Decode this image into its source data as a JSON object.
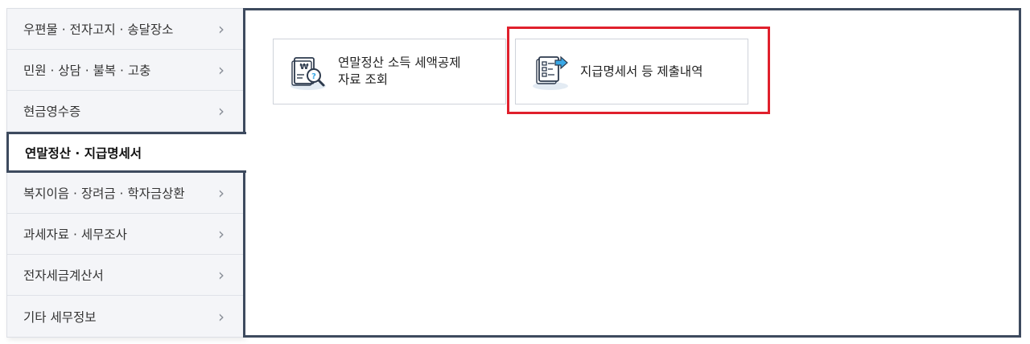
{
  "sidebar": {
    "items": [
      {
        "label": "우편물 · 전자고지 · 송달장소",
        "chevron": "›"
      },
      {
        "label": "민원 · 상담 · 불복 · 고충",
        "chevron": "›"
      },
      {
        "label": "현금영수증",
        "chevron": "›"
      },
      {
        "label": "연말정산 · 지급명세서",
        "chevron": ""
      },
      {
        "label": "복지이음 · 장려금 · 학자금상환",
        "chevron": "›"
      },
      {
        "label": "과세자료 · 세무조사",
        "chevron": "›"
      },
      {
        "label": "전자세금계산서",
        "chevron": "›"
      },
      {
        "label": "기타 세무정보",
        "chevron": "›"
      }
    ],
    "active_index": 3
  },
  "cards": [
    {
      "label_line1": "연말정산 소득 세액공제",
      "label_line2": "자료 조회",
      "icon": "tax-document-search-icon"
    },
    {
      "label_line1": "지급명세서 등 제출내역",
      "label_line2": "",
      "icon": "document-submit-icon"
    }
  ],
  "colors": {
    "active_border": "#3d4a5e",
    "highlight": "#e0202c",
    "sidebar_bg": "#f4f5f8",
    "icon_accent": "#3aa8e6"
  }
}
